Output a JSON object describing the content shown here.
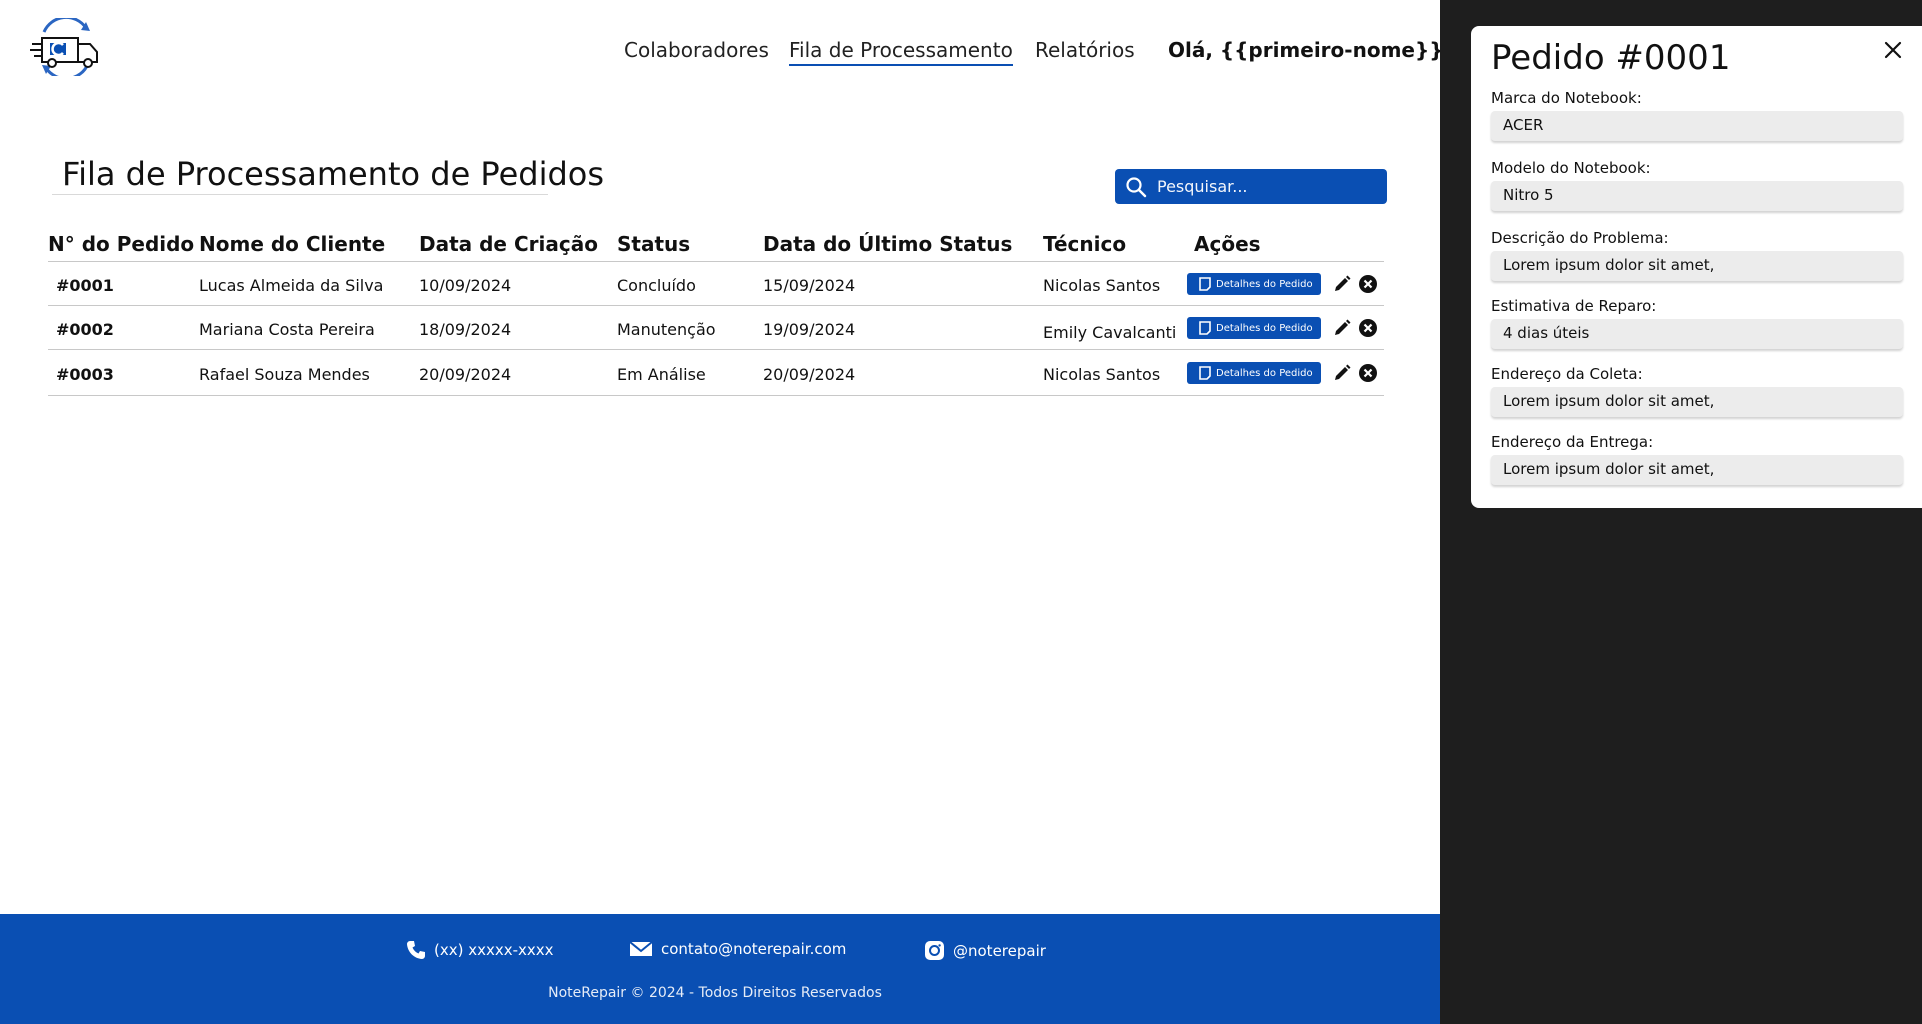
{
  "nav": {
    "items": [
      "Colaboradores",
      "Fila de Processamento",
      "Relatórios"
    ],
    "active": "Fila de Processamento",
    "greeting": "Olá, {{primeiro-nome}}"
  },
  "page": {
    "title": "Fila de Processamento de Pedidos"
  },
  "search": {
    "placeholder": "Pesquisar..."
  },
  "table": {
    "headers": [
      "N° do Pedido",
      "Nome do Cliente",
      "Data de Criação",
      "Status",
      "Data do Último Status",
      "Técnico",
      "Ações"
    ],
    "rows": [
      {
        "id": "#0001",
        "client": "Lucas Almeida da Silva",
        "created": "10/09/2024",
        "status": "Concluído",
        "last_status": "15/09/2024",
        "tech": "Nicolas Santos",
        "details_label": "Detalhes do Pedido"
      },
      {
        "id": "#0002",
        "client": "Mariana Costa Pereira",
        "created": "18/09/2024",
        "status": "Manutenção",
        "last_status": "19/09/2024",
        "tech": "Emily Cavalcanti",
        "details_label": "Detalhes do Pedido"
      },
      {
        "id": "#0003",
        "client": "Rafael Souza Mendes",
        "created": "20/09/2024",
        "status": "Em Análise",
        "last_status": "20/09/2024",
        "tech": "Nicolas Santos",
        "details_label": "Detalhes do Pedido"
      }
    ]
  },
  "footer": {
    "phone": "(xx) xxxxx-xxxx",
    "email": "contato@noterepair.com",
    "instagram": "@noterepair",
    "copyright": "NoteRepair © 2024 - Todos Direitos Reservados"
  },
  "panel": {
    "title": "Pedido #0001",
    "fields": [
      {
        "label": "Marca do Notebook:",
        "value": "ACER"
      },
      {
        "label": "Modelo do Notebook:",
        "value": "Nitro 5"
      },
      {
        "label": "Descrição do Problema:",
        "value": "Lorem ipsum dolor sit amet,"
      },
      {
        "label": "Estimativa de Reparo:",
        "value": "4 dias úteis"
      },
      {
        "label": "Endereço da Coleta:",
        "value": "Lorem ipsum dolor sit amet,"
      },
      {
        "label": "Endereço da Entrega:",
        "value": "Lorem ipsum dolor sit amet,"
      }
    ]
  },
  "colors": {
    "brand_blue": "#0a4fb3",
    "panel_backdrop": "#1e1e1e"
  },
  "icons": {
    "logo": "truck-laptop-logo-icon",
    "search": "search-icon",
    "details": "document-icon",
    "edit": "pencil-icon",
    "delete": "close-circle-icon",
    "phone": "phone-icon",
    "email": "envelope-icon",
    "instagram": "instagram-icon",
    "close": "close-icon"
  }
}
